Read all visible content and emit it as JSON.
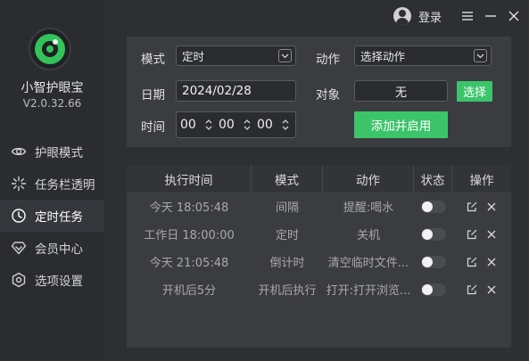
{
  "app": {
    "name": "小智护眼宝",
    "version": "V2.0.32.66"
  },
  "sidebar": {
    "items": [
      {
        "label": "护眼模式",
        "icon": "eye-icon"
      },
      {
        "label": "任务栏透明",
        "icon": "sparkle-icon"
      },
      {
        "label": "定时任务",
        "icon": "clock-icon",
        "active": true
      },
      {
        "label": "会员中心",
        "icon": "diamond-icon"
      },
      {
        "label": "选项设置",
        "icon": "gear-icon"
      }
    ]
  },
  "topbar": {
    "login_label": "登录"
  },
  "form": {
    "mode_label": "模式",
    "mode_value": "定时",
    "action_label": "动作",
    "action_value": "选择动作",
    "date_label": "日期",
    "date_value": "2024/02/28",
    "target_label": "对象",
    "target_value": "无",
    "select_button": "选择",
    "time_label": "时间",
    "time_h": "00",
    "time_m": "00",
    "time_s": "00",
    "add_button": "添加并启用"
  },
  "table": {
    "headers": [
      "执行时间",
      "模式",
      "动作",
      "状态",
      "操作"
    ],
    "rows": [
      {
        "time": "今天 18:05:48",
        "mode": "间隔",
        "action": "提醒:喝水",
        "enabled": false
      },
      {
        "time": "工作日 18:00:00",
        "mode": "定时",
        "action": "关机",
        "enabled": false
      },
      {
        "time": "今天 21:05:48",
        "mode": "倒计时",
        "action": "清空临时文件...",
        "enabled": false
      },
      {
        "time": "开机后5分",
        "mode": "开机后执行",
        "action": "打开:打开浏览...",
        "enabled": false
      }
    ]
  },
  "colors": {
    "accent": "#3cc46b",
    "sidebar_bg": "#2b2c30",
    "panel_bg": "#3b3c40"
  }
}
